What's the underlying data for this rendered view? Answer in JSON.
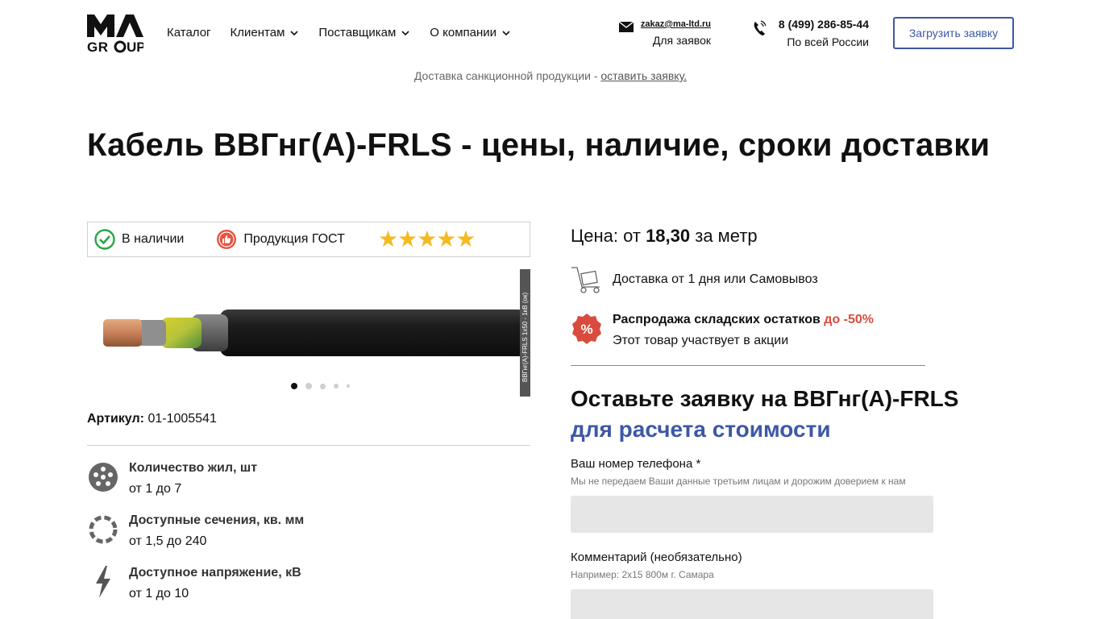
{
  "header": {
    "logo_text": "MA GROUP",
    "nav": [
      "Каталог",
      "Клиентам",
      "Поставщикам",
      "О компании"
    ],
    "email": "zakaz@ma-ltd.ru",
    "email_sub": "Для заявок",
    "phone": "8 (499) 286-85-44",
    "phone_sub": "По всей России",
    "upload_button": "Загрузить заявку"
  },
  "notice": {
    "text": "Доставка санкционной продукции - ",
    "link": "оставить заявку."
  },
  "title": "Кабель ВВГнг(А)-FRLS - цены, наличие, сроки доставки",
  "badges": {
    "in_stock": "В наличии",
    "gost": "Продукция ГОСТ",
    "rating_stars": 5
  },
  "product_image": {
    "side_label": "ВВГнг(А)-FRLS 1х50 - 1кВ (ок)",
    "slides": 5,
    "active_slide": 1
  },
  "sku": {
    "label": "Артикул:",
    "value": "01-1005541"
  },
  "specs": [
    {
      "title": "Количество жил, шт",
      "value": "от 1 до 7",
      "icon": "cores-icon"
    },
    {
      "title": "Доступные сечения, кв. мм",
      "value": "от 1,5 до 240",
      "icon": "section-icon"
    },
    {
      "title": "Доступное напряжение, кВ",
      "value": "от 1 до 10",
      "icon": "voltage-icon"
    }
  ],
  "price": {
    "prefix": "Цена: от ",
    "amount": "18,30",
    "currency_glyph": "",
    "suffix": " за метр"
  },
  "delivery": "Доставка от 1 дня или Самовывоз",
  "sale": {
    "title": "Распродажа складских остатков ",
    "highlight": "до -50%",
    "subtitle": "Этот товар участвует в акции"
  },
  "form": {
    "title": "Оставьте заявку на ВВГнг(А)-FRLS",
    "subtitle": "для расчета стоимости",
    "phone_label": "Ваш номер телефона *",
    "phone_hint": "Мы не передаем Ваши данные третьим лицам и дорожим доверием к нам",
    "comment_label": "Комментарий (необязательно)",
    "comment_hint": "Например: 2х15 800м г. Самара"
  },
  "colors": {
    "accent": "#3d58a4",
    "sale_red": "#d94c3d",
    "star": "#f5b921",
    "stock_green": "#2aa641"
  }
}
